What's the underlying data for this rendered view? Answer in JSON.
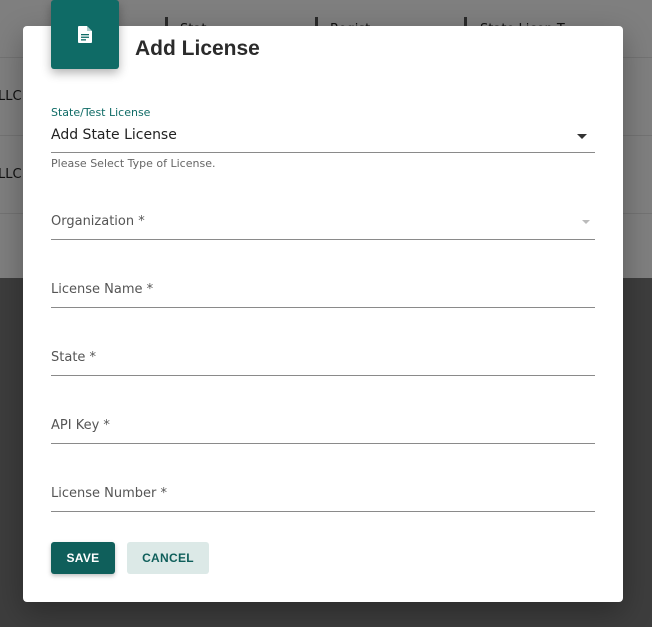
{
  "background": {
    "columns": [
      "Stat",
      "Regist",
      "State Licen   T"
    ],
    "row_fragments": [
      "LLC",
      "LLC"
    ]
  },
  "dialog": {
    "title": "Add License",
    "icon": "document-icon",
    "license_type": {
      "label": "State/Test License",
      "value": "Add State License",
      "helper": "Please Select Type of License."
    },
    "organization": {
      "placeholder": "Organization *"
    },
    "license_name": {
      "placeholder": "License Name *"
    },
    "state": {
      "placeholder": "State *"
    },
    "api_key": {
      "placeholder": "API Key *"
    },
    "license_number": {
      "placeholder": "License Number *"
    },
    "buttons": {
      "save": "SAVE",
      "cancel": "CANCEL"
    }
  },
  "colors": {
    "primary": "#0f6b66",
    "cancel_bg": "#dce9e7"
  }
}
